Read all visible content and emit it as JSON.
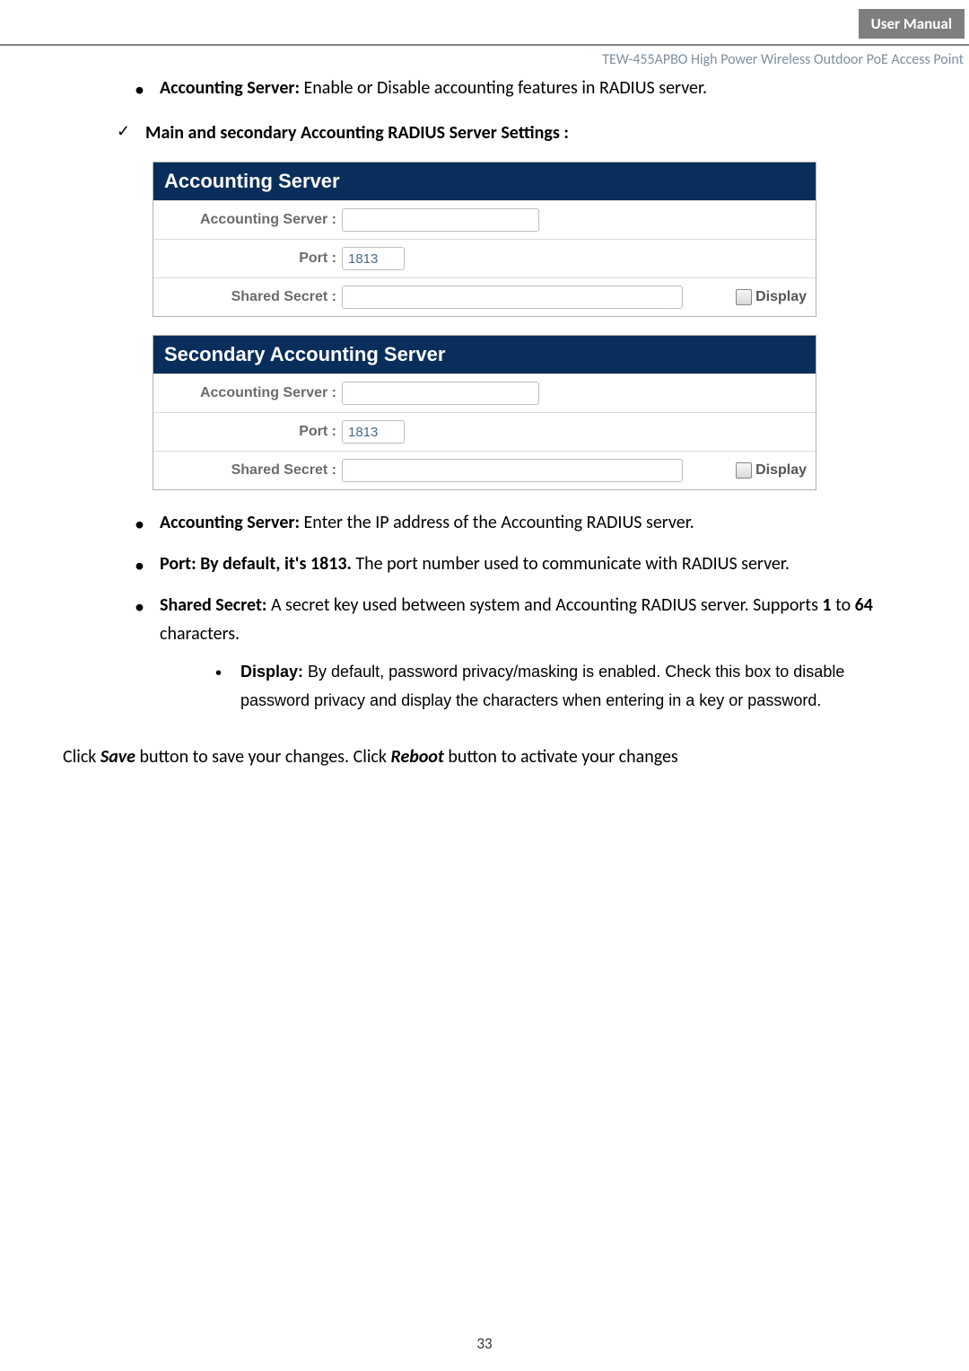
{
  "header": {
    "badge": "User Manual",
    "subtitle": "TEW-455APBO High Power Wireless Outdoor PoE Access Point"
  },
  "intro_bullet": {
    "label": "Accounting Server:",
    "text": " Enable or Disable accounting features in RADIUS server."
  },
  "section_heading": "Main and secondary Accounting RADIUS Server Settings :",
  "panel1": {
    "title": "Accounting Server",
    "row_server_label": "Accounting Server :",
    "row_server_value": "",
    "row_port_label": "Port :",
    "row_port_value": "1813",
    "row_secret_label": "Shared Secret :",
    "row_secret_value": "",
    "display_label": "Display"
  },
  "panel2": {
    "title": "Secondary Accounting Server",
    "row_server_label": "Accounting Server :",
    "row_server_value": "",
    "row_port_label": "Port :",
    "row_port_value": "1813",
    "row_secret_label": "Shared Secret :",
    "row_secret_value": "",
    "display_label": "Display"
  },
  "desc": {
    "b1_label": "Accounting Server:",
    "b1_text": " Enter the IP address of the Accounting RADIUS server.",
    "b2_label": "Port: By default, it's 1813.",
    "b2_text": " The port number used to communicate with RADIUS server.",
    "b3_label": "Shared Secret:",
    "b3_text_a": " A secret key used between system and Accounting RADIUS server. Supports ",
    "b3_bold_a": "1",
    "b3_text_b": " to ",
    "b3_bold_b": "64",
    "b3_text_c": " characters.",
    "sub_label": "Display:",
    "sub_text": " By default, password privacy/masking is enabled. Check this box to disable password privacy and display the characters when entering in a key or password."
  },
  "closing": {
    "t1": "Click ",
    "b1": "Save",
    "t2": " button to save your changes. Click ",
    "b2": "Reboot",
    "t3": " button to activate your changes"
  },
  "pagenum": "33"
}
